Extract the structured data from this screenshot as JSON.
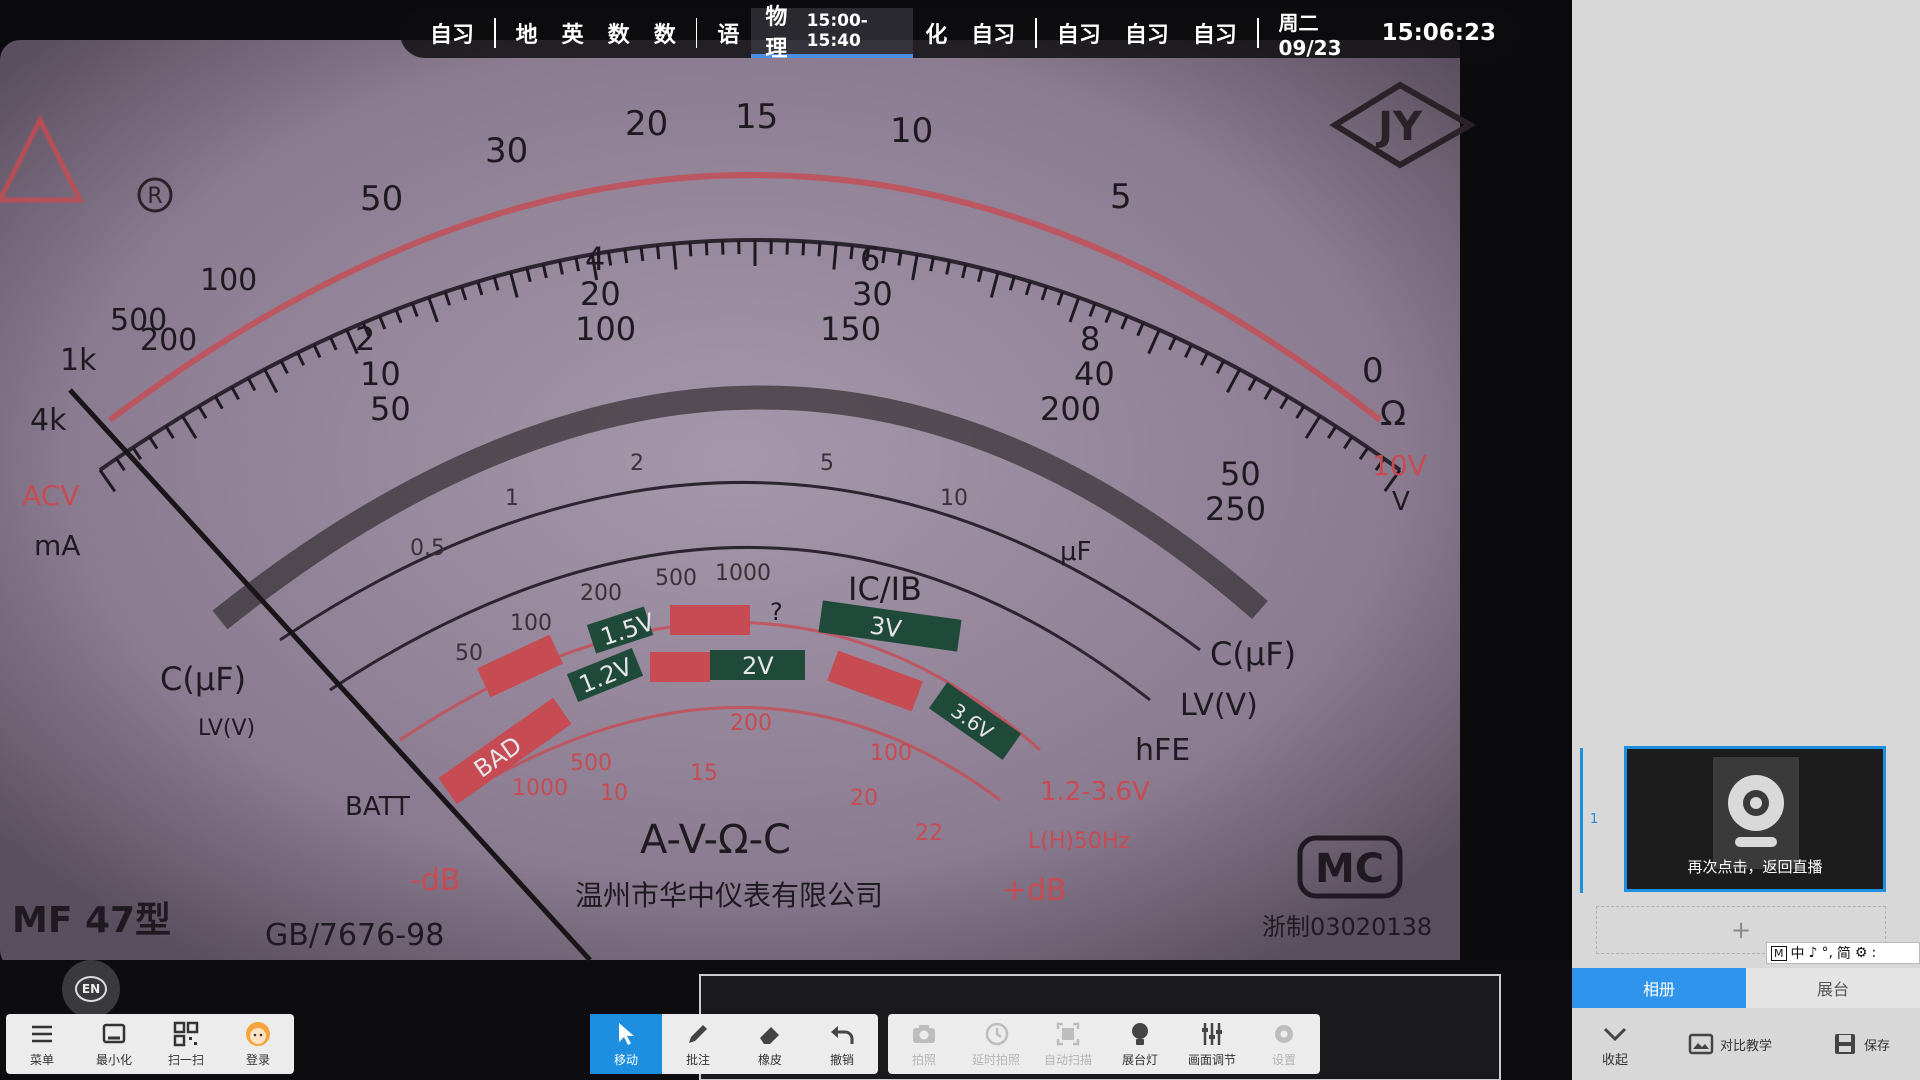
{
  "schedule": {
    "items": [
      "自习",
      "地",
      "英",
      "数",
      "数",
      "语",
      "物理",
      "化",
      "自习",
      "自习",
      "自习",
      "自习"
    ],
    "active_subject": "物理",
    "active_time": "15:00-15:40",
    "date": "周二 09/23",
    "time": "15:06:23"
  },
  "meter": {
    "top_scale": [
      "50",
      "30",
      "20",
      "15",
      "10",
      "5",
      "0"
    ],
    "left_numbers": [
      "1k",
      "4k",
      "500",
      "200",
      "100"
    ],
    "mid_scale_a": [
      "2",
      "4",
      "6",
      "8"
    ],
    "mid_scale_b": [
      "10",
      "20",
      "30",
      "40",
      "50"
    ],
    "mid_scale_c": [
      "50",
      "100",
      "150",
      "200",
      "250"
    ],
    "ohm_symbol": "Ω",
    "v_label": "V",
    "ohm_range": "10V",
    "acv_label": "ACV",
    "ma_label": "mA",
    "c_label_left": "C(μF)",
    "c_label_right": "C(μF)",
    "lv_label_left": "LV(V)",
    "lv_label_right": "LV(V)",
    "hfe_label": "hFE",
    "ic_ib_label": "IC/IB",
    "uf_label": "μF",
    "hfe_scale": [
      "50",
      "100",
      "200",
      "500",
      "1000"
    ],
    "inner_scale": [
      "0.5",
      "1",
      "2",
      "5",
      "10"
    ],
    "batt_label": "BATT",
    "bad_label": "BAD",
    "batt_boxes": [
      "1.5V",
      "1.2V",
      "2V",
      "3V",
      "3.6V"
    ],
    "question_mark": "?",
    "dB_scale": [
      "1000",
      "500",
      "200",
      "100",
      "10",
      "15",
      "20",
      "22"
    ],
    "minus_db": "-dB",
    "plus_db": "+dB",
    "v_range_label": "1.2-3.6V",
    "l_label": "L(H)50Hz",
    "brand": "A-V-Ω-C",
    "company": "温州市华中仪表有限公司",
    "model": "MF 47型",
    "standard": "GB/7676-98",
    "mc_mark": "MC",
    "cert_no": "浙制03020138",
    "r_mark": "R"
  },
  "toolbar_left": [
    {
      "label": "菜单",
      "icon": "menu-icon"
    },
    {
      "label": "最小化",
      "icon": "minimize-icon"
    },
    {
      "label": "扫一扫",
      "icon": "qr-icon"
    },
    {
      "label": "登录",
      "icon": "avatar-icon"
    }
  ],
  "toolbar_mid": [
    {
      "label": "移动",
      "icon": "pointer-icon"
    },
    {
      "label": "批注",
      "icon": "pen-icon"
    },
    {
      "label": "橡皮",
      "icon": "eraser-icon"
    },
    {
      "label": "撤销",
      "icon": "undo-icon"
    }
  ],
  "toolbar_right": [
    {
      "label": "拍照",
      "icon": "camera-icon"
    },
    {
      "label": "延时拍照",
      "icon": "timer-icon"
    },
    {
      "label": "自动扫描",
      "icon": "scan-icon"
    },
    {
      "label": "展台灯",
      "icon": "bulb-icon"
    },
    {
      "label": "画面调节",
      "icon": "sliders-icon"
    },
    {
      "label": "设置",
      "icon": "gear-icon"
    }
  ],
  "lang_badge": "EN",
  "sidebar": {
    "page_number": "1",
    "thumbnail_caption": "再次点击，返回直播",
    "add_label": "+",
    "ime": [
      "M",
      "中",
      "♪",
      "°,",
      "简",
      "⚙",
      ":"
    ],
    "tabs": [
      "相册",
      "展台"
    ],
    "actions": [
      {
        "label": "收起",
        "icon": "chevron-down-icon"
      },
      {
        "label": "对比教学",
        "icon": "compare-icon"
      },
      {
        "label": "保存",
        "icon": "save-icon"
      }
    ]
  },
  "colors": {
    "accent": "#1e8fe0",
    "meter_face": "#8d7e93",
    "red_arc": "#c74b52",
    "green_box": "#1f4a3a"
  }
}
